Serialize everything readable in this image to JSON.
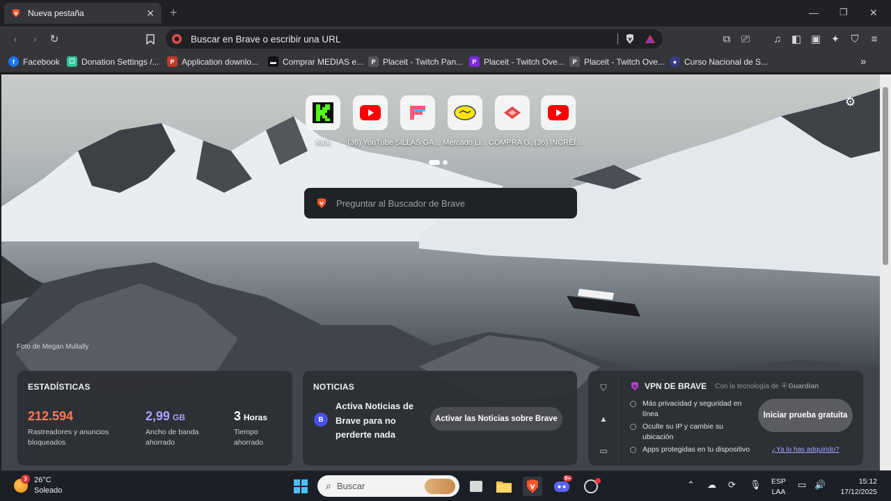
{
  "tab": {
    "title": "Nueva pestaña"
  },
  "toolbar": {
    "url_placeholder": "Buscar en Brave o escribir una URL"
  },
  "bookmarks": [
    {
      "label": "Facebook",
      "icon": "facebook-icon",
      "color": "#1877f2",
      "glyph": "f"
    },
    {
      "label": "Donation Settings /...",
      "icon": "streamelements-icon",
      "color": "#35c4a0",
      "glyph": "☐"
    },
    {
      "label": "Application downlo...",
      "icon": "application-icon",
      "color": "#c0392b",
      "glyph": "P"
    },
    {
      "label": "Comprar MEDIAS e...",
      "icon": "store-icon",
      "color": "#111111",
      "glyph": "▬"
    },
    {
      "label": "Placeit - Twitch Pan...",
      "icon": "placeit-icon",
      "color": "#555555",
      "glyph": "P"
    },
    {
      "label": "Placeit - Twitch Ove...",
      "icon": "placeit-purple-icon",
      "color": "#7b2bd9",
      "glyph": "P"
    },
    {
      "label": "Placeit - Twitch Ove...",
      "icon": "placeit-icon",
      "color": "#555555",
      "glyph": "P"
    },
    {
      "label": "Curso Nacional de S...",
      "icon": "course-icon",
      "color": "#3a3a8a",
      "glyph": "●"
    }
  ],
  "tiles": [
    {
      "label": "Kick",
      "icon": "kick-icon"
    },
    {
      "label": "(36) YouTube",
      "icon": "youtube-icon"
    },
    {
      "label": "SILLAS GA...",
      "icon": "sillas-icon"
    },
    {
      "label": "Mercado Li...",
      "icon": "mercadolibre-icon"
    },
    {
      "label": "COMPRA G...",
      "icon": "compra-icon"
    },
    {
      "label": "(36) INCREÍ...",
      "icon": "youtube-icon"
    }
  ],
  "search": {
    "placeholder": "Preguntar al Buscador de Brave"
  },
  "photo_credit": "Foto de Megan Mullally",
  "stats": {
    "title": "ESTADÍSTICAS",
    "trackers": {
      "value": "212.594",
      "desc": "Rastreadores y anuncios bloqueados",
      "color": "#ff7a55"
    },
    "bandwidth": {
      "value": "2,99",
      "unit": "GB",
      "desc": "Ancho de banda ahorrado",
      "color": "#a7a3ff"
    },
    "time": {
      "value": "3",
      "unit": "Horas",
      "desc": "Tiempo ahorrado",
      "color": "#ffffff"
    }
  },
  "news": {
    "title": "NOTICIAS",
    "badge": "B",
    "text": "Activa Noticias de Brave para no perderte nada",
    "button": "Activar las Noticias sobre Brave"
  },
  "vpn": {
    "title": "VPN DE BRAVE",
    "powered_by": "Con la tecnología de",
    "partner": "Guardian",
    "features": [
      "Más privacidad y seguridad en línea",
      "Oculte su IP y cambie su ubicación",
      "Apps protegidas en tu dispositivo"
    ],
    "button": "Iniciar prueba gratuita",
    "link": "¿Ya lo has adquirido?"
  },
  "taskbar": {
    "weather_temp": "26°C",
    "weather_desc": "Soleado",
    "weather_badge": "3",
    "search_label": "Buscar",
    "discord_badge": "9+",
    "lang_top": "ESP",
    "lang_bottom": "LAA",
    "time": "15:12",
    "date": "17/12/2025"
  }
}
